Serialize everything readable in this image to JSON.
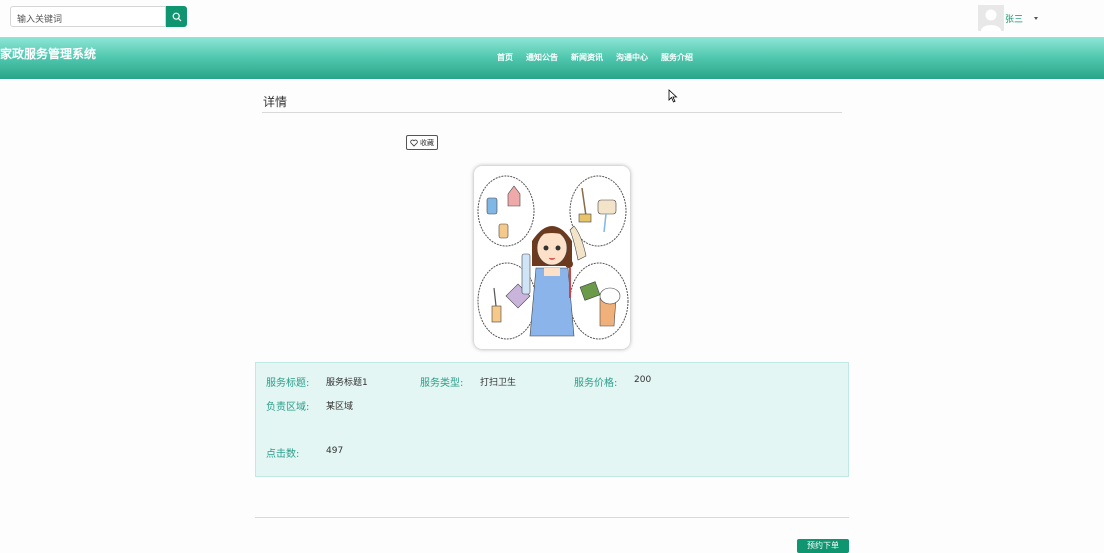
{
  "search": {
    "placeholder": "输入关键词"
  },
  "user": {
    "name": "张三"
  },
  "header": {
    "site_title": "家政服务管理系统",
    "nav": [
      "首页",
      "通知公告",
      "新闻资讯",
      "沟通中心",
      "服务介绍"
    ]
  },
  "detail": {
    "title": "详情",
    "favorite_label": "收藏",
    "fields": {
      "service_title_label": "服务标题:",
      "service_title_value": "服务标题1",
      "service_type_label": "服务类型:",
      "service_type_value": "打扫卫生",
      "service_price_label": "服务价格:",
      "service_price_value": "200",
      "region_label": "负责区域:",
      "region_value": "某区域",
      "clicks_label": "点击数:",
      "clicks_value": "497"
    },
    "action_label": "预约下单"
  },
  "colors": {
    "accent": "#0f9670",
    "header_light": "#8ee6d6",
    "header_dark": "#2aa489",
    "panel_bg": "#e3f6f3"
  }
}
